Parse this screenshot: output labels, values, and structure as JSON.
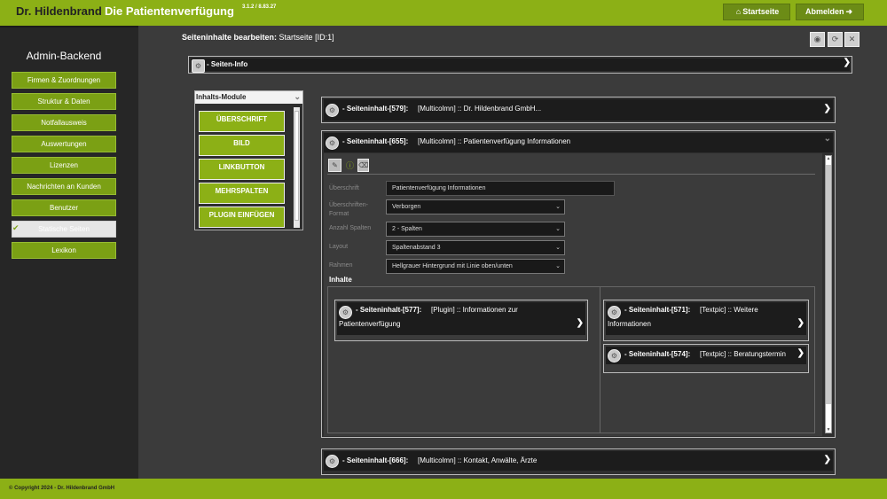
{
  "header": {
    "brand": "Dr. Hildenbrand",
    "product": "Die Patientenverfügung",
    "version": "3.1.2 / 8.83.27",
    "btn_start": "Startseite",
    "btn_logout": "Abmelden"
  },
  "sidebar": {
    "title": "Admin-Backend",
    "items": [
      {
        "label": "Firmen & Zuordnungen"
      },
      {
        "label": "Struktur & Daten"
      },
      {
        "label": "Notfallausweis"
      },
      {
        "label": "Auswertungen"
      },
      {
        "label": "Lizenzen"
      },
      {
        "label": "Nachrichten an Kunden"
      },
      {
        "label": "Benutzer"
      },
      {
        "label": "Statische Seiten",
        "active": true
      },
      {
        "label": "Lexikon"
      }
    ]
  },
  "main": {
    "title_bold": "Seiteninhalte bearbeiten:",
    "title_rest": "Startseite [ID:1]",
    "seiten_info": "- Seiten-Info",
    "modules": {
      "title": "Inhalts-Module",
      "items": [
        "ÜBERSCHRIFT",
        "BILD",
        "LINKBUTTON",
        "MEHRSPALTEN",
        "PLUGIN EINFÜGEN"
      ]
    },
    "blocks": {
      "b579": {
        "name": "- Seiteninhalt-[579]:",
        "desc": "[Multicolmn] :: Dr. Hildenbrand GmbH..."
      },
      "b655": {
        "name": "- Seiteninhalt-[655]:",
        "desc": "[Multicolmn] :: Patientenverfügung Informationen"
      },
      "b666": {
        "name": "- Seiteninhalt-[666]:",
        "desc": "[Multicolmn] :: Kontakt, Anwälte, Ärzte"
      }
    },
    "form": {
      "ueberschrift_label": "Überschrift",
      "ueberschrift_value": "Patientenverfügung Informationen",
      "format_label": "Überschriften-\nFormat",
      "format_value": "Verborgen",
      "spalten_label": "Anzahl Spalten",
      "spalten_value": "2 - Spalten",
      "layout_label": "Layout",
      "layout_value": "Spaltenabstand 3",
      "rahmen_label": "Rahmen",
      "rahmen_value": "Hellgrauer Hintergrund mit Linie oben/unten",
      "inhalte_label": "Inhalte"
    },
    "sub": {
      "s577_name": "- Seiteninhalt-[577]:",
      "s577_desc": "[Plugin] :: Informationen zur",
      "s577_desc2": "Patientenverfügung",
      "s571_name": "- Seiteninhalt-[571]:",
      "s571_desc": "[Textpic] :: Weitere",
      "s571_desc2": "Informationen",
      "s574_name": "- Seiteninhalt-[574]:",
      "s574_desc": "[Textpic] :: Beratungstermin"
    }
  },
  "footer": {
    "copyright": "© Copyright 2024 - Dr. Hildenbrand GmbH"
  }
}
